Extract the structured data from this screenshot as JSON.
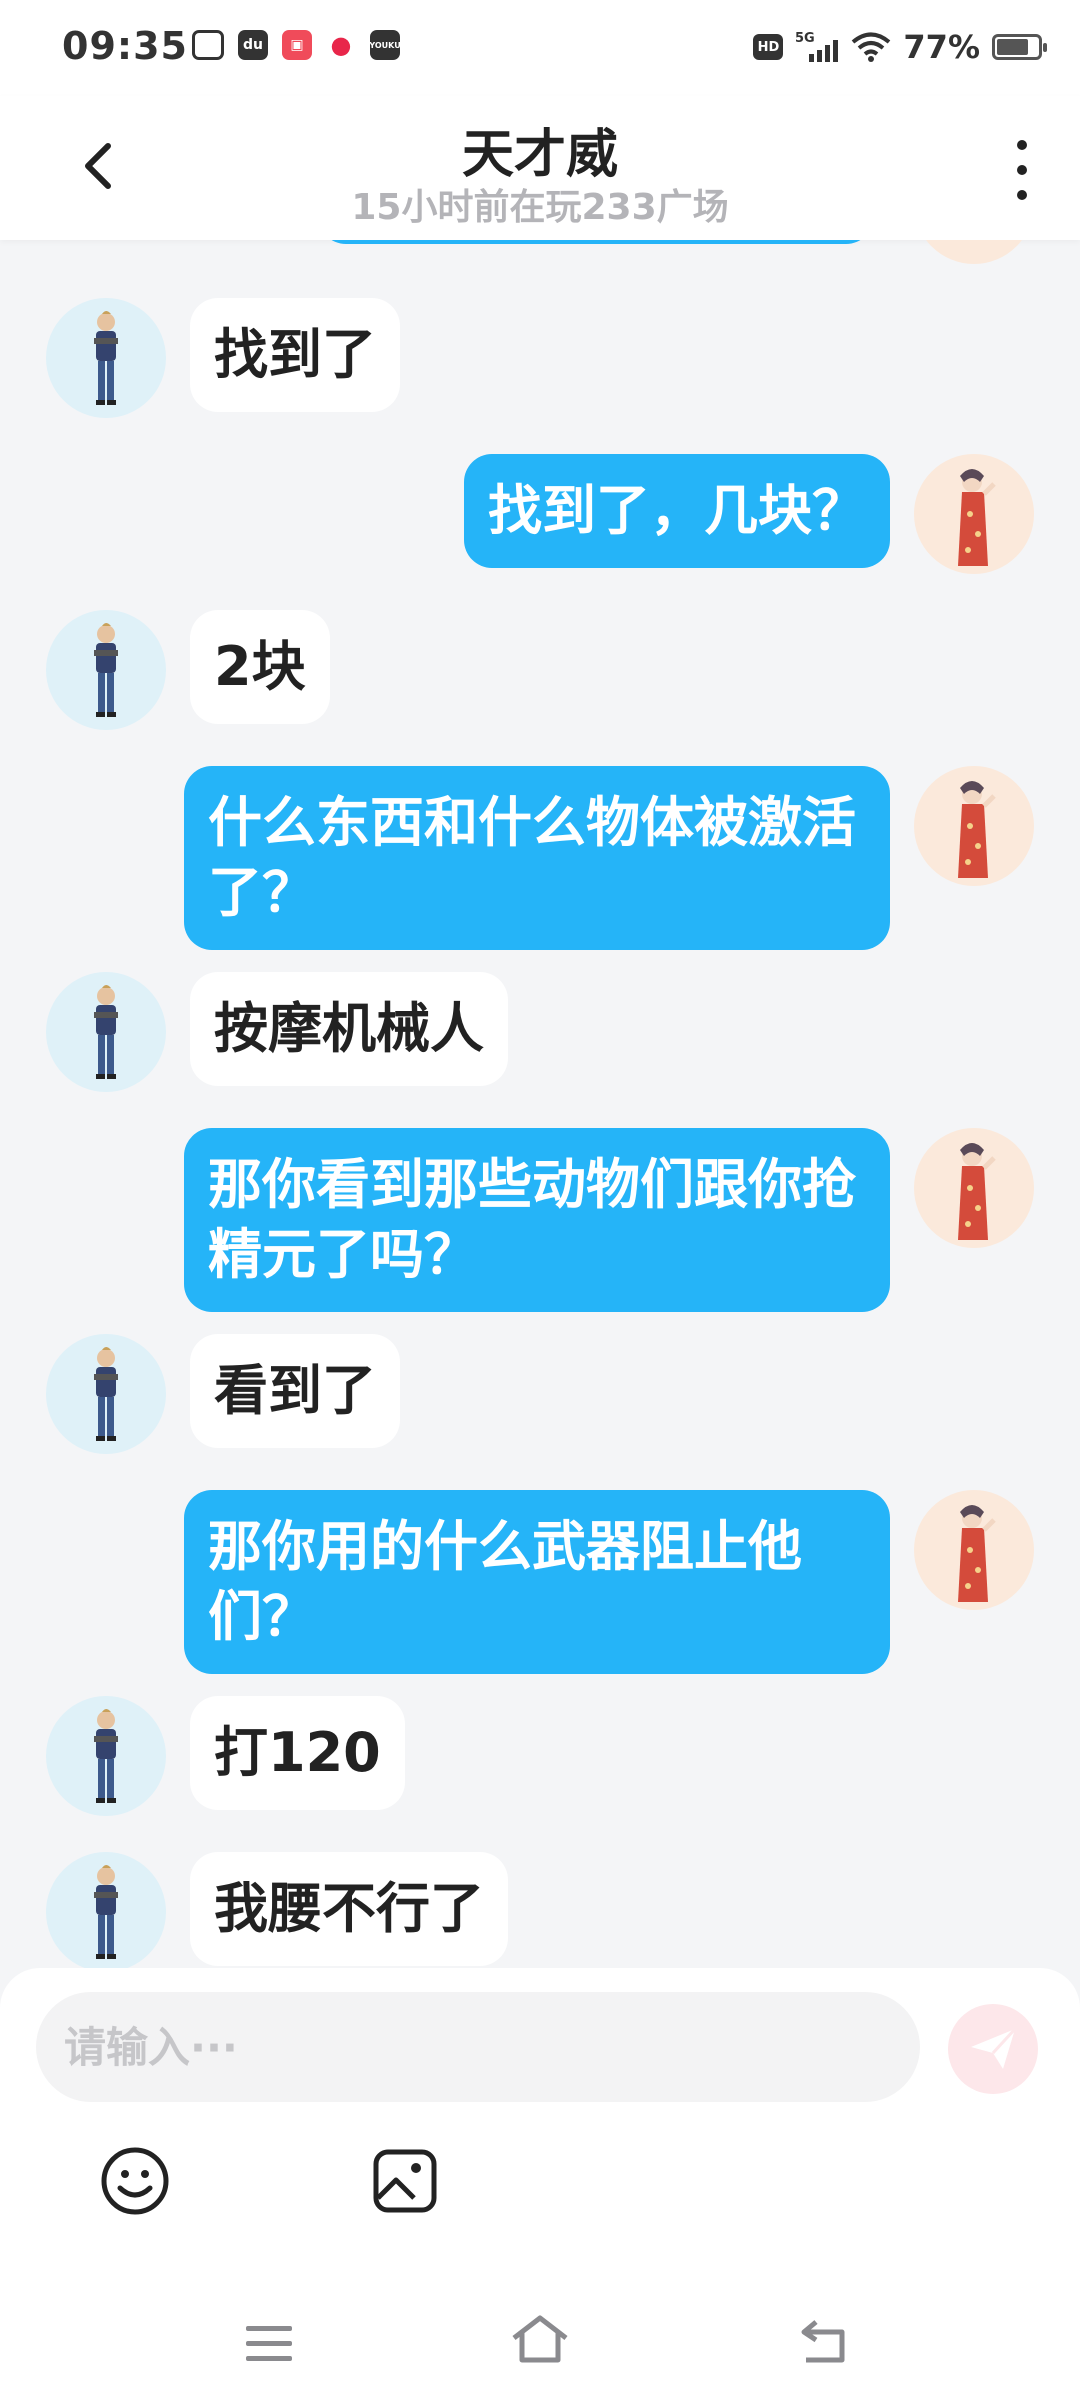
{
  "status_bar": {
    "time": "09:35",
    "network": "5G",
    "battery_percent": "77%",
    "battery_level": 0.77,
    "app_icons": [
      "bilibili-tv-icon",
      "du-icon",
      "kuaishou-icon",
      "weibo-icon",
      "youku-icon"
    ]
  },
  "header": {
    "title": "天才威",
    "subtitle": "15小时前在玩233广场"
  },
  "messages": [
    {
      "side": "left",
      "text": "找到了"
    },
    {
      "side": "right",
      "text": "找到了，几块？"
    },
    {
      "side": "left",
      "text": "2块"
    },
    {
      "side": "right",
      "text": "什么东西和什么物体被激活了？"
    },
    {
      "side": "left",
      "text": "按摩机械人"
    },
    {
      "side": "right",
      "text": "那你看到那些动物们跟你抢精元了吗？"
    },
    {
      "side": "left",
      "text": "看到了"
    },
    {
      "side": "right",
      "text": "那你用的什么武器阻止他们？"
    },
    {
      "side": "left",
      "text": "打120"
    },
    {
      "side": "left",
      "text": "我腰不行了"
    }
  ],
  "input": {
    "placeholder": "请输入···"
  },
  "colors": {
    "accent": "#25b4f8",
    "background": "#f4f5f7",
    "send_disabled": "#fde7ea"
  },
  "icons": {
    "back": "chevron-left-icon",
    "more": "more-vertical-icon",
    "send": "paper-plane-icon",
    "emoji": "smiley-icon",
    "image": "image-icon"
  }
}
